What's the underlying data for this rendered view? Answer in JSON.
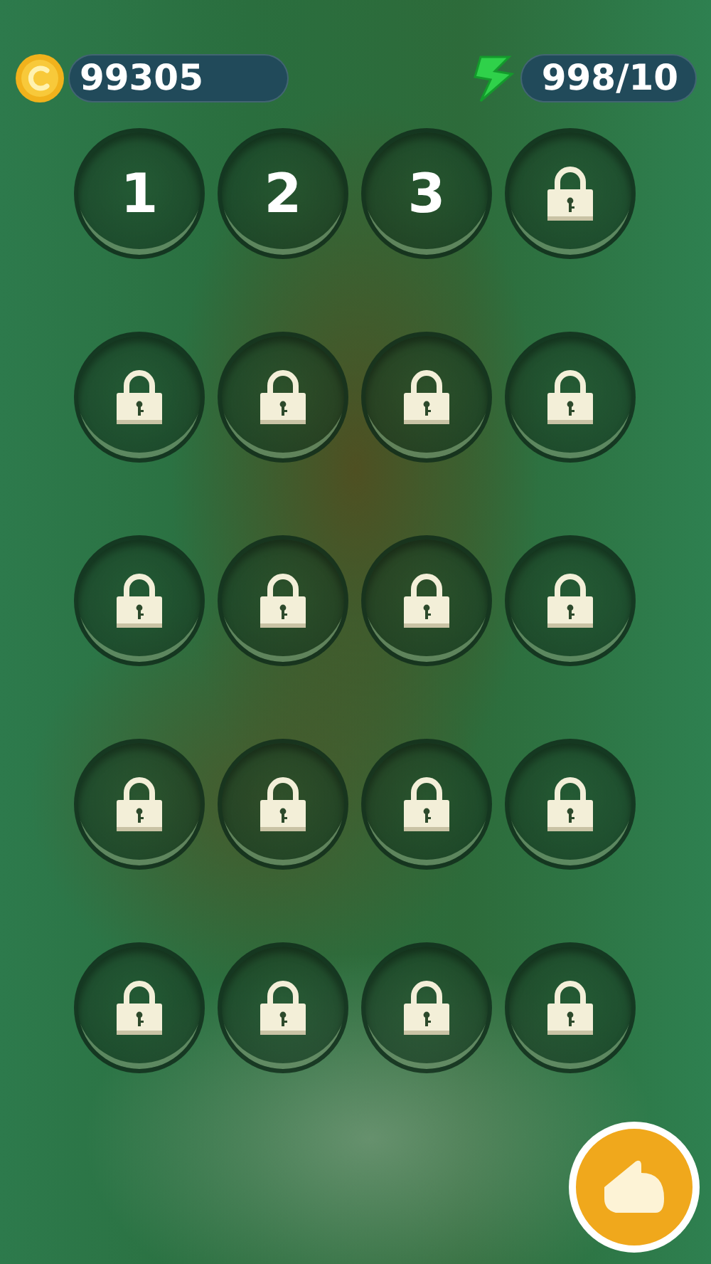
{
  "coins": {
    "value": "99305"
  },
  "energy": {
    "value": "998/10"
  },
  "levels": [
    {
      "kind": "number",
      "label": "1"
    },
    {
      "kind": "number",
      "label": "2"
    },
    {
      "kind": "number",
      "label": "3"
    },
    {
      "kind": "locked"
    },
    {
      "kind": "locked"
    },
    {
      "kind": "locked"
    },
    {
      "kind": "locked"
    },
    {
      "kind": "locked"
    },
    {
      "kind": "locked"
    },
    {
      "kind": "locked"
    },
    {
      "kind": "locked"
    },
    {
      "kind": "locked"
    },
    {
      "kind": "locked"
    },
    {
      "kind": "locked"
    },
    {
      "kind": "locked"
    },
    {
      "kind": "locked"
    },
    {
      "kind": "locked"
    },
    {
      "kind": "locked"
    },
    {
      "kind": "locked"
    },
    {
      "kind": "locked"
    }
  ]
}
